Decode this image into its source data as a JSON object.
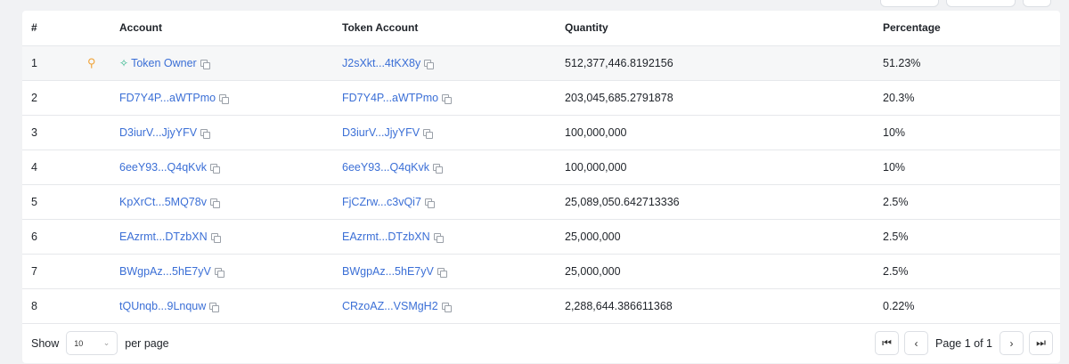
{
  "columns": {
    "index": "#",
    "account": "Account",
    "token_account": "Token Account",
    "quantity": "Quantity",
    "percentage": "Percentage"
  },
  "rows": [
    {
      "index": "1",
      "account": "Token Owner",
      "token_account": "J2sXkt...4tKX8y",
      "quantity": "512,377,446.8192156",
      "percentage": "51.23%"
    },
    {
      "index": "2",
      "account": "FD7Y4P...aWTPmo",
      "token_account": "FD7Y4P...aWTPmo",
      "quantity": "203,045,685.2791878",
      "percentage": "20.3%"
    },
    {
      "index": "3",
      "account": "D3iurV...JjyYFV",
      "token_account": "D3iurV...JjyYFV",
      "quantity": "100,000,000",
      "percentage": "10%"
    },
    {
      "index": "4",
      "account": "6eeY93...Q4qKvk",
      "token_account": "6eeY93...Q4qKvk",
      "quantity": "100,000,000",
      "percentage": "10%"
    },
    {
      "index": "5",
      "account": "KpXrCt...5MQ78v",
      "token_account": "FjCZrw...c3vQi7",
      "quantity": "25,089,050.642713336",
      "percentage": "2.5%"
    },
    {
      "index": "6",
      "account": "EAzrmt...DTzbXN",
      "token_account": "EAzrmt...DTzbXN",
      "quantity": "25,000,000",
      "percentage": "2.5%"
    },
    {
      "index": "7",
      "account": "BWgpAz...5hE7yV",
      "token_account": "BWgpAz...5hE7yV",
      "quantity": "25,000,000",
      "percentage": "2.5%"
    },
    {
      "index": "8",
      "account": "tQUnqb...9Lnquw",
      "token_account": "CRzoAZ...VSMgH2",
      "quantity": "2,288,644.386611368",
      "percentage": "0.22%"
    }
  ],
  "footer": {
    "show_label": "Show",
    "page_size": "10",
    "per_page_label": "per page",
    "page_info": "Page 1 of 1"
  },
  "icons": {
    "first": "⏮",
    "prev": "‹",
    "next": "›",
    "last": "⏭"
  },
  "colors": {
    "link": "#3b6fd6",
    "owner_icon": "#f0a43a",
    "sparkle": "#2fb58a"
  }
}
